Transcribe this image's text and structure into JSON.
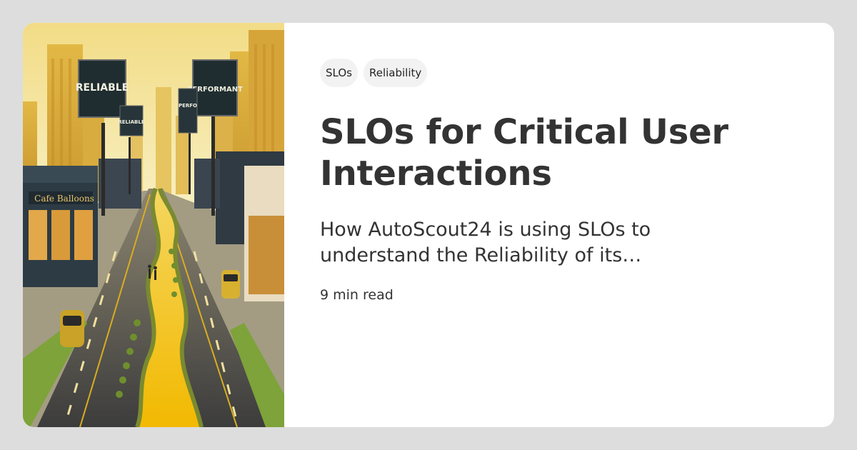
{
  "tags": [
    "SLOs",
    "Reliability"
  ],
  "title": "SLOs for Critical User Interactions",
  "subtitle": "How AutoScout24 is using SLOs to understand the Reliability of its…",
  "read_time": "9 min read",
  "image": {
    "billboard_left": "RELIABLE",
    "billboard_left_small": "RELIABLE",
    "billboard_right": "PERFORMANT",
    "billboard_right_small": "PERFO",
    "shop_sign": "Cafe Balloons"
  }
}
